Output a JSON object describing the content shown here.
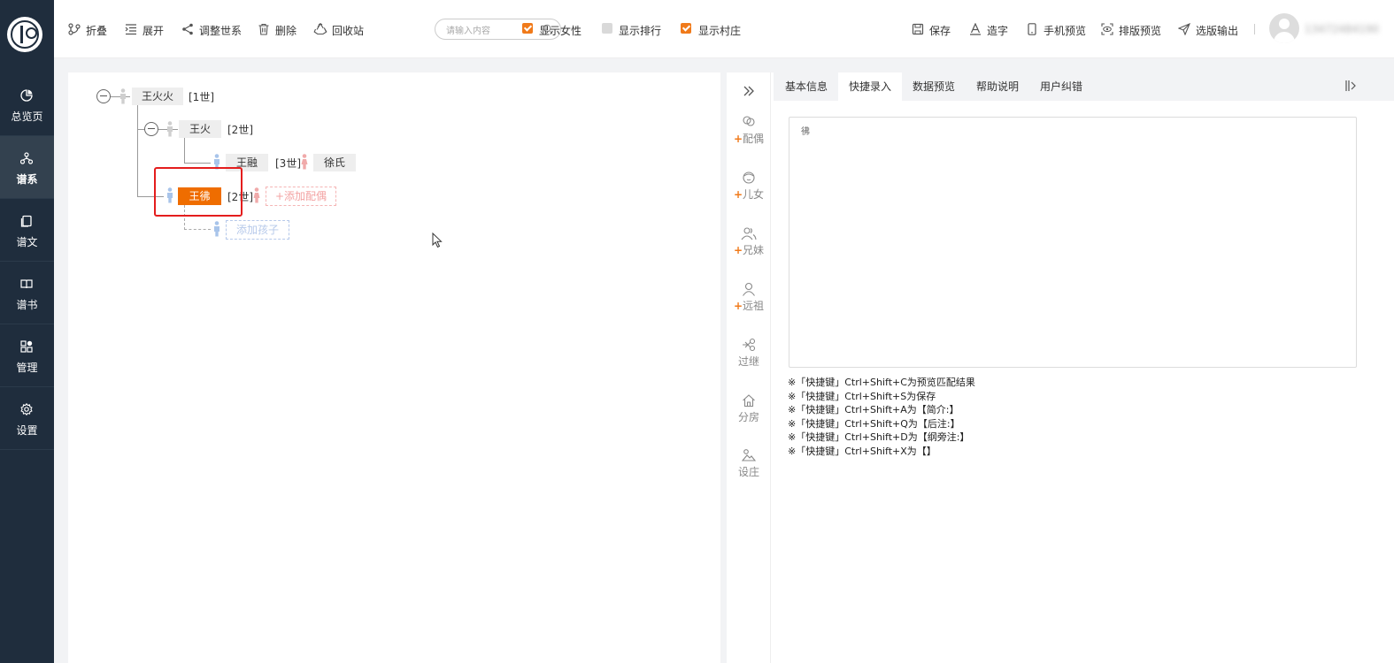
{
  "nav": [
    {
      "icon": "pie-chart-icon",
      "label": "总览页"
    },
    {
      "icon": "tree-icon",
      "label": "谱系"
    },
    {
      "icon": "document-icon",
      "label": "谱文"
    },
    {
      "icon": "book-icon",
      "label": "谱书"
    },
    {
      "icon": "grid-icon",
      "label": "管理"
    },
    {
      "icon": "gear-icon",
      "label": "设置"
    }
  ],
  "toolbar": {
    "fold": "折叠",
    "expand": "展开",
    "adjust": "调整世系",
    "delete": "删除",
    "recycle": "回收站",
    "search_placeholder": "请输入内容",
    "show_female": "显示女性",
    "show_rank": "显示排行",
    "show_village": "显示村庄",
    "save": "保存",
    "make_char": "造字",
    "mobile_preview": "手机预览",
    "layout_preview": "排版预览",
    "export": "选版输出",
    "username": "13472484190"
  },
  "checks": {
    "female": true,
    "rank": false,
    "village": true
  },
  "tree": {
    "root": {
      "name": "王火火",
      "gen": "[1世]"
    },
    "child": {
      "name": "王火",
      "gen": "[2世]"
    },
    "grandchild": {
      "name": "王融",
      "gen": "[3世]",
      "spouse": "徐氏"
    },
    "selected": {
      "name": "王彿",
      "gen": "[2世]",
      "add_spouse": "+添加配偶"
    },
    "add_child": "添加孩子"
  },
  "tools": [
    {
      "icon": "spouse-icon",
      "plus": "+",
      "label": "配偶"
    },
    {
      "icon": "child-icon",
      "plus": "+",
      "label": "儿女"
    },
    {
      "icon": "siblings-icon",
      "plus": "+",
      "label": "兄妹"
    },
    {
      "icon": "ancestor-icon",
      "plus": "+",
      "label": "远祖"
    },
    {
      "icon": "adopt-icon",
      "plus": "",
      "label": "过继"
    },
    {
      "icon": "house-icon",
      "plus": "",
      "label": "分房"
    },
    {
      "icon": "village-icon",
      "plus": "",
      "label": "设庄"
    }
  ],
  "tabs": [
    "基本信息",
    "快捷录入",
    "数据预览",
    "帮助说明",
    "用户纠错"
  ],
  "active_tab": 1,
  "textarea_value": "彿",
  "hints": [
    "※「快捷键」Ctrl+Shift+C为预览匹配结果",
    "※「快捷键」Ctrl+Shift+S为保存",
    "※「快捷键」Ctrl+Shift+A为【简介:】",
    "※「快捷键」Ctrl+Shift+Q为【后注:】",
    "※「快捷键」Ctrl+Shift+D为【纲旁注:】",
    "※「快捷键」Ctrl+Shift+X为【】"
  ],
  "colors": {
    "accent": "#ef6d00",
    "sidebar": "#1f2d3d",
    "highlight": "#e41d1d"
  }
}
